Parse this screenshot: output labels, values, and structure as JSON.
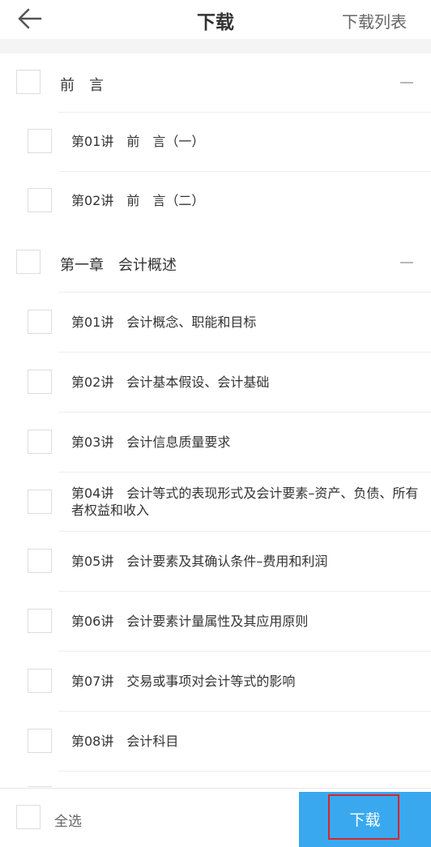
{
  "header": {
    "back_icon": "arrow-left-icon",
    "title": "下载",
    "action_label": "下载列表"
  },
  "chapters": [
    {
      "label": "前　言",
      "collapse_icon": "minus-icon",
      "lectures": [
        {
          "label": "第01讲　前　言（一）"
        },
        {
          "label": "第02讲　前　言（二）"
        }
      ]
    },
    {
      "label": "第一章　会计概述",
      "collapse_icon": "minus-icon",
      "lectures": [
        {
          "label": "第01讲　会计概念、职能和目标"
        },
        {
          "label": "第02讲　会计基本假设、会计基础"
        },
        {
          "label": "第03讲　会计信息质量要求"
        },
        {
          "label": "第04讲　会计等式的表现形式及会计要素–资产、负债、所有者权益和收入"
        },
        {
          "label": "第05讲　会计要素及其确认条件–费用和利润"
        },
        {
          "label": "第06讲　会计要素计量属性及其应用原则"
        },
        {
          "label": "第07讲　交易或事项对会计等式的影响"
        },
        {
          "label": "第08讲　会计科目"
        }
      ]
    }
  ],
  "footer": {
    "select_all_label": "全选",
    "download_label": "下载"
  },
  "colors": {
    "accent": "#39a8ef",
    "highlight_border": "#d9262a",
    "divider": "#eeeeee",
    "checkbox_border": "#dddddd"
  }
}
